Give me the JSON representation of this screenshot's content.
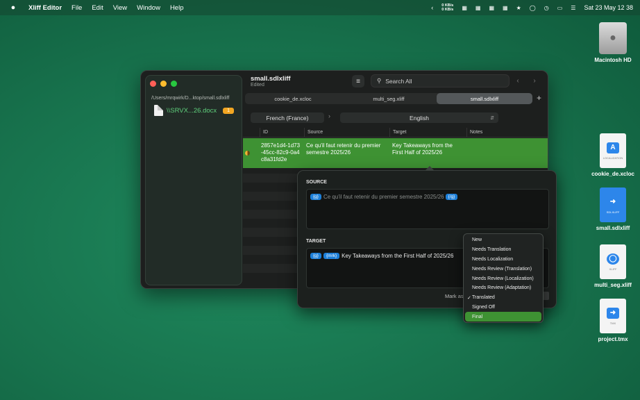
{
  "menubar": {
    "app_name": "Xliff Editor",
    "menus": [
      "File",
      "Edit",
      "View",
      "Window",
      "Help"
    ],
    "net_up": "0 KB/s",
    "net_down": "0 KB/s",
    "datetime": "Sat 23 May  12 38"
  },
  "window": {
    "title": "small.sdlxliff",
    "subtitle": "Edited",
    "search_placeholder": "Search All",
    "sidebar": {
      "path": "/Users/mrqwirk/D...ktop/small.sdlxliff",
      "file_name": "\\\\SRVX...26.docx",
      "file_badge": "1"
    },
    "tabs": [
      {
        "label": "cookie_de.xcloc",
        "active": false
      },
      {
        "label": "multi_seg.xliff",
        "active": false
      },
      {
        "label": "small.sdlxliff",
        "active": true
      }
    ],
    "source_language": "French (France)",
    "target_language": "English",
    "columns": [
      "ID",
      "Source",
      "Target",
      "Notes"
    ],
    "selected_row": {
      "id": "2857e1d4-1d73-45cc-82c9-0a4c8a31fd2e",
      "source": "Ce qu'il faut retenir du premier semestre 2025/26",
      "target": "Key Takeaways from the First Half of 2025/26",
      "notes": ""
    }
  },
  "popover": {
    "source_label": "SOURCE",
    "target_label": "TARGET",
    "source_tags": [
      "{g}",
      "{/g}"
    ],
    "source_text": "Ce qu'il faut retenir du premier semestre 2025/26",
    "target_tags": [
      "{g}",
      "{mrk}"
    ],
    "target_text": "Key Takeaways from the First Half of 2025/26",
    "mark_as_label": "Mark as"
  },
  "status_menu": {
    "items": [
      {
        "label": "New",
        "checked": false,
        "highlighted": false
      },
      {
        "label": "Needs Translation",
        "checked": false,
        "highlighted": false
      },
      {
        "label": "Needs Localization",
        "checked": false,
        "highlighted": false
      },
      {
        "label": "Needs Review (Translation)",
        "checked": false,
        "highlighted": false
      },
      {
        "label": "Needs Review (Localization)",
        "checked": false,
        "highlighted": false
      },
      {
        "label": "Needs Review (Adaptation)",
        "checked": false,
        "highlighted": false
      },
      {
        "label": "Translated",
        "checked": true,
        "highlighted": false
      },
      {
        "label": "Signed Off",
        "checked": false,
        "highlighted": false
      },
      {
        "label": "Final",
        "checked": false,
        "highlighted": true
      }
    ]
  },
  "desktop": {
    "items": [
      {
        "label": "Macintosh HD",
        "icon": "hard-drive-icon"
      },
      {
        "label": "cookie_de.xcloc",
        "icon": "localization-file-icon",
        "sublabel": "LOCALIZATION"
      },
      {
        "label": "small.sdlxliff",
        "icon": "sdlxliff-file-icon",
        "sublabel": "SDLXLIFF"
      },
      {
        "label": "multi_seg.xliff",
        "icon": "xliff-file-icon",
        "sublabel": "XLIFF"
      },
      {
        "label": "project.tmx",
        "icon": "tmx-file-icon",
        "sublabel": "TMX"
      }
    ]
  }
}
